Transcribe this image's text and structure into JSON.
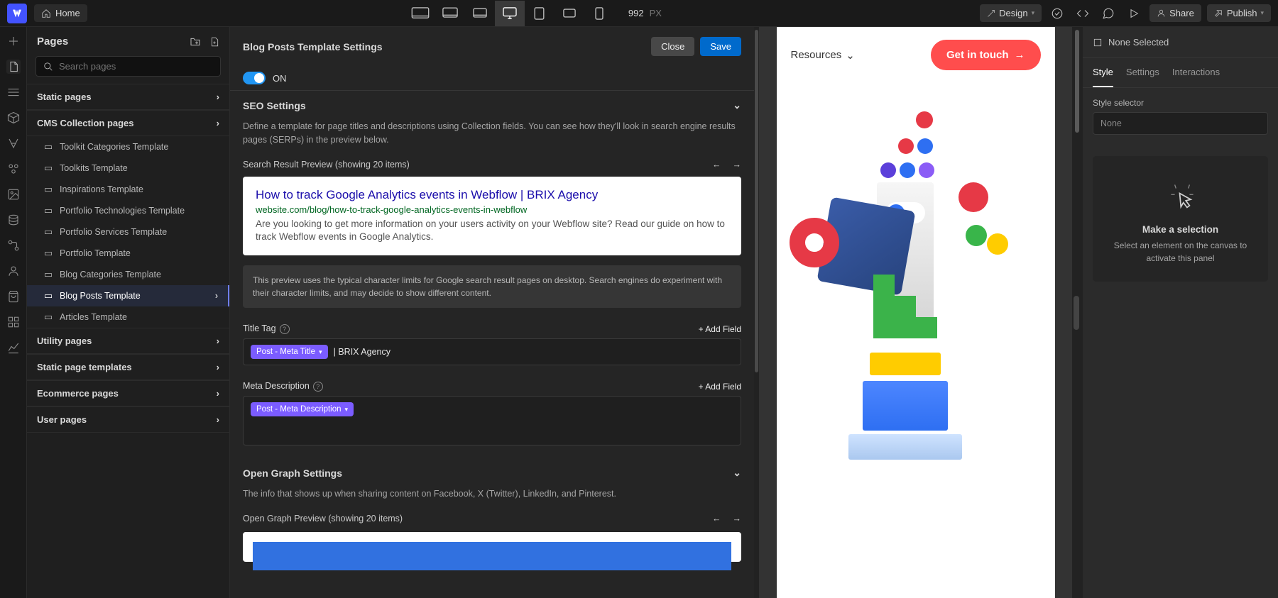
{
  "topbar": {
    "home": "Home",
    "canvas_width": "992",
    "px": "PX",
    "design": "Design",
    "share": "Share",
    "publish": "Publish"
  },
  "pages": {
    "title": "Pages",
    "search_placeholder": "Search pages",
    "groups": {
      "static": "Static pages",
      "cms": "CMS Collection pages",
      "utility": "Utility pages",
      "static_tpl": "Static page templates",
      "ecommerce": "Ecommerce pages",
      "user": "User pages"
    },
    "cms_items": [
      "Toolkit Categories Template",
      "Toolkits Template",
      "Inspirations Template",
      "Portfolio Technologies Template",
      "Portfolio Services Template",
      "Portfolio Template",
      "Blog Categories Template",
      "Blog Posts Template",
      "Articles Template"
    ]
  },
  "settings": {
    "title": "Blog Posts Template Settings",
    "close": "Close",
    "save": "Save",
    "toggle_label": "ON",
    "seo_header": "SEO Settings",
    "seo_desc": "Define a template for page titles and descriptions using Collection fields. You can see how they'll look in search engine results pages (SERPs) in the preview below.",
    "preview_label": "Search Result Preview (showing 20 items)",
    "serp_title": "How to track Google Analytics events in Webflow | BRIX Agency",
    "serp_url": "website.com/blog/how-to-track-google-analytics-events-in-webflow",
    "serp_desc": "Are you looking to get more information on your users activity on your Webflow site? Read our guide on how to track Webflow events in Google Analytics.",
    "note": "This preview uses the typical character limits for Google search result pages on desktop. Search engines do experiment with their character limits, and may decide to show different content.",
    "title_tag_label": "Title Tag",
    "add_field": "+ Add Field",
    "chip_title": "Post - Meta Title",
    "chip_title_suffix": "| BRIX Agency",
    "meta_desc_label": "Meta Description",
    "chip_desc": "Post - Meta Description",
    "og_header": "Open Graph Settings",
    "og_desc": "The info that shows up when sharing content on Facebook, X (Twitter), LinkedIn, and Pinterest.",
    "og_preview_label": "Open Graph Preview (showing 20 items)"
  },
  "site": {
    "resources": "Resources",
    "git": "Get in touch"
  },
  "right": {
    "selected": "None Selected",
    "tabs": {
      "style": "Style",
      "settings": "Settings",
      "interactions": "Interactions"
    },
    "style_selector": "Style selector",
    "none": "None",
    "ph_title": "Make a selection",
    "ph_desc": "Select an element on the canvas to activate this panel"
  }
}
